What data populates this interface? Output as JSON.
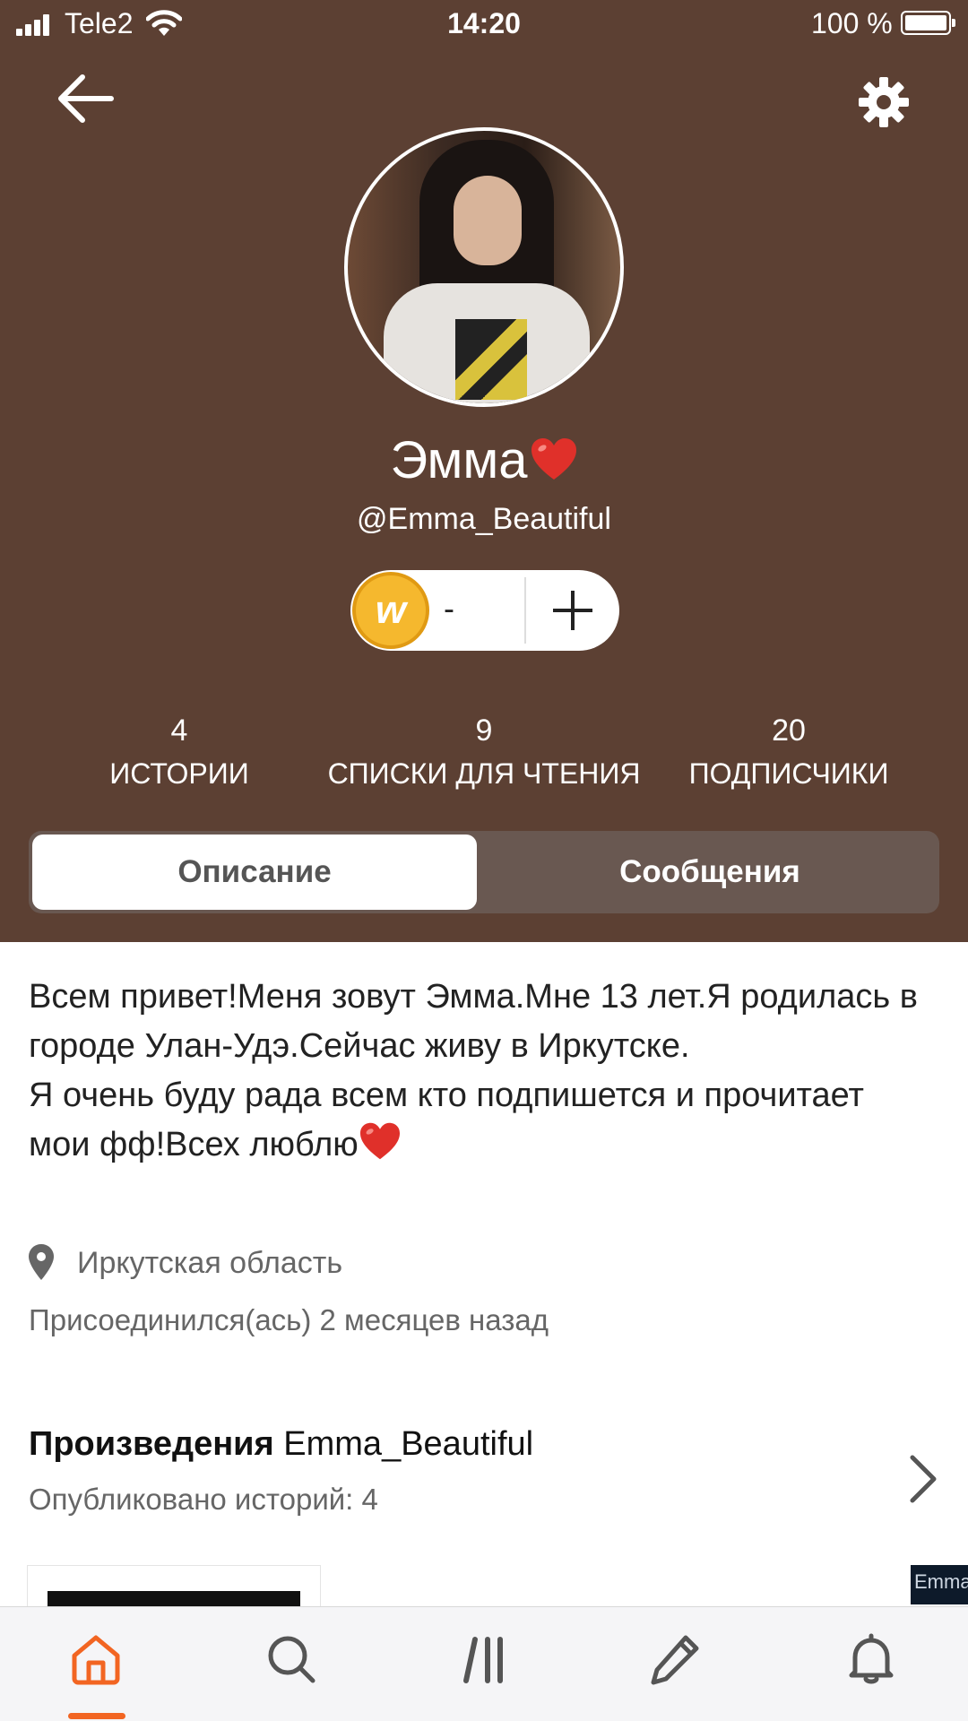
{
  "status_bar": {
    "carrier": "Tele2",
    "time": "14:20",
    "battery_percent": "100 %"
  },
  "profile": {
    "display_name": "Эмма",
    "username": "@Emma_Beautiful",
    "coins_value": "-"
  },
  "stats": [
    {
      "value": "4",
      "label": "ИСТОРИИ"
    },
    {
      "value": "9",
      "label": "СПИСКИ ДЛЯ ЧТЕНИЯ"
    },
    {
      "value": "20",
      "label": "ПОДПИСЧИКИ"
    }
  ],
  "tabs": {
    "active": "Описание",
    "inactive": "Сообщения"
  },
  "about": {
    "bio_line1": "Всем привет!Меня зовут Эмма.Мне 13 лет.Я родилась в городе Улан-Удэ.Сейчас живу в Иркутске.",
    "bio_line2": "Я очень буду рада всем кто подпишется и прочитает мои фф!Всех люблю",
    "location": "Иркутская область",
    "joined": "Присоединился(ась) 2 месяцев назад"
  },
  "works": {
    "title_bold": "Произведения",
    "title_user": "Emma_Beautiful",
    "subtitle": "Опубликовано историй: 4",
    "peek_cover_text": "Emma"
  },
  "icons": {
    "back": "arrow-left-icon",
    "settings": "gear-icon",
    "heart": "red-heart-emoji",
    "coin": "wattpad-coin-icon",
    "plus": "plus-icon",
    "location": "map-pin-icon",
    "chevron": "chevron-right-icon",
    "home": "home-icon",
    "search": "search-icon",
    "library": "library-icon",
    "write": "pencil-icon",
    "notifications": "bell-icon"
  },
  "colors": {
    "header_bg": "#5c4033",
    "segment_bg": "#695851",
    "accent": "#f26522",
    "coin": "#f5b82e",
    "heart": "#e0302a"
  }
}
